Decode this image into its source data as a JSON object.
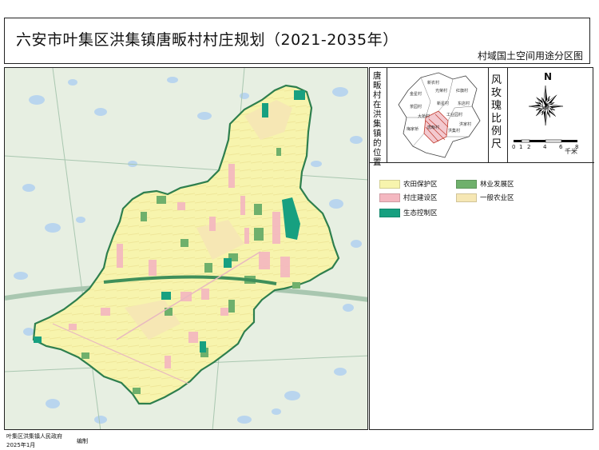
{
  "header": {
    "title": "六安市叶集区洪集镇唐畈村村庄规划（2021-2035年）",
    "subtitle": "村域国土空间用途分区图"
  },
  "location_panel": {
    "label": "唐畈村在洪集镇的位置",
    "place_names": [
      "新农村",
      "金星村",
      "光荣村",
      "红旗村",
      "茶园村",
      "东店村",
      "新星村",
      "大桥村",
      "工业园村",
      "洪家村",
      "梅家桥",
      "唐畈村",
      "洪集村"
    ]
  },
  "rose_panel": {
    "label": "风玫瑰比例尺",
    "north": "N",
    "scale_ticks": [
      "0",
      "1",
      "2",
      "4",
      "6",
      "8"
    ],
    "scale_unit": "千米"
  },
  "legend": {
    "items": [
      {
        "label": "农田保护区",
        "color": "#f7f4ad"
      },
      {
        "label": "林业发展区",
        "color": "#6fb06c"
      },
      {
        "label": "村庄建设区",
        "color": "#f4b7c0"
      },
      {
        "label": "一般农业区",
        "color": "#f6e7b4"
      },
      {
        "label": "生态控制区",
        "color": "#17a080"
      }
    ]
  },
  "footer": {
    "org": "叶集区洪集镇人民政府",
    "date": "2025年1月",
    "role": "编制"
  },
  "colors": {
    "background_land": "#e9f1e4",
    "water": "#b9d5ee",
    "boundary": "#2e7f4e",
    "road": "#8fb59a"
  }
}
